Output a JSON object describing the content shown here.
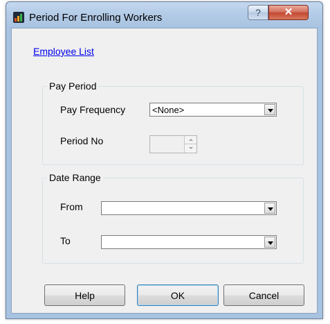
{
  "window": {
    "title": "Period For Enrolling Workers",
    "help_glyph": "?",
    "close_glyph": "✕",
    "icon": "chart-app-icon"
  },
  "link": {
    "employee_list": "Employee List"
  },
  "pay_period": {
    "legend": "Pay Period",
    "frequency_label": "Pay Frequency",
    "frequency_value": "<None>",
    "period_label": "Period No",
    "period_value": ""
  },
  "date_range": {
    "legend": "Date Range",
    "from_label": "From",
    "from_value": "",
    "to_label": "To",
    "to_value": ""
  },
  "buttons": {
    "help": "Help",
    "ok": "OK",
    "cancel": "Cancel"
  },
  "colors": {
    "title_bar": "#b3cbe6",
    "close_button": "#c24631",
    "link": "#0000ee",
    "dialog_background": "#f0f0f0"
  }
}
